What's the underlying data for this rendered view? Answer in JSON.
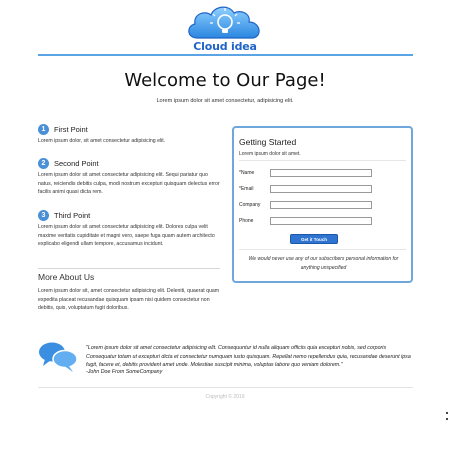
{
  "header": {
    "logo_text": "Cloud idea",
    "colors": {
      "accent": "#5aa4e6",
      "brand": "#1f63c8"
    }
  },
  "hero": {
    "title": "Welcome to Our Page!",
    "subtitle": "Lorem ipsum dolor sit amet consectetur, adipisicing elit."
  },
  "features": [
    {
      "number": "1",
      "title": "First Point",
      "text": "Lorem ipsum dolor, sit amet consectetur adipisicing elit."
    },
    {
      "number": "2",
      "title": "Second Point",
      "text": "Lorem ipsum dolor sit amet consectetur adipisicing elit. Sequi pariatur quo natus, reiciendis debitis culpa, modi nostrum excepturi quisquam delectus error facilis animi quasi dicta rem."
    },
    {
      "number": "3",
      "title": "Third Point",
      "text": "Lorem ipsum dolor sit amet consectetur adipisicing elit. Dolores culpa velit maxime veritatis cupiditate et magni vero, saepe fuga quam autem architecto explicabo eligendi ullam tempore, accusamus incidunt."
    }
  ],
  "more_about": {
    "title": "More About Us",
    "text": "Lorem ipsum dolor sit, amet consectetur adipisicing elit. Deleniti, quaerat quam expedita placeat recusandae quisquam ipsam nisi quidem consectetur non debitis, quis, voluptatum fugit doloribus."
  },
  "form": {
    "title": "Getting Started",
    "subtitle": "Lorem ipsum dolor sit amet.",
    "fields": [
      {
        "label": "*Name",
        "value": ""
      },
      {
        "label": "*Email",
        "value": ""
      },
      {
        "label": "Company",
        "value": ""
      },
      {
        "label": "Phone",
        "value": ""
      }
    ],
    "submit_label": "Get it Touch",
    "privacy": "We would never use any of our subscribers personal information for anything unspecified"
  },
  "testimonial": {
    "quote": "\"Lorem ipsum dolor sit amet consectetur adipisicing elit. Consequuntur id nulla aliquam officiis quia excepturi nobis, sed corporis Consequatur totam ut excepturi dicta et consectetur numquam iusto quisquam. Repellat nemo repellendus quia, recusandae deserunt ipsa fugit, facere et, debitis provident amet unde. Molestiae suscipit minima, voluptas labore quo veniam dolorem.\"",
    "author": "-John Doe From SomeCompany"
  },
  "footer": {
    "copyright": "Copyright © 2019"
  }
}
